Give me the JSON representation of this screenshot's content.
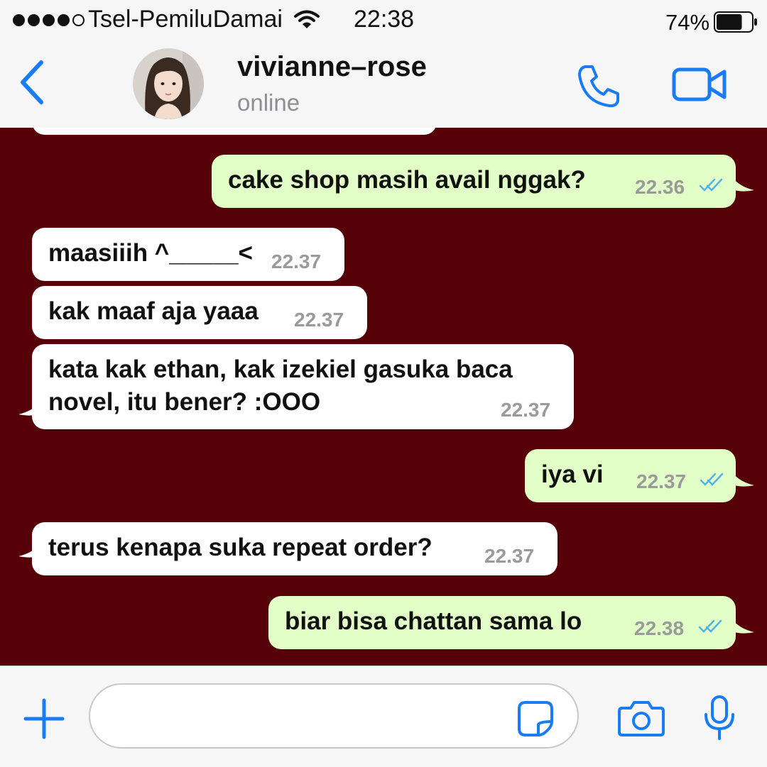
{
  "status_bar": {
    "carrier": "Tsel-PemiluDamai",
    "time": "22:38",
    "battery_percent": "74%",
    "battery_level": 0.74,
    "signal_bars_filled": 4,
    "signal_bars_total": 5,
    "icons": [
      "signal-dots-icon",
      "wifi-icon",
      "battery-icon"
    ]
  },
  "header": {
    "contact_name": "vivianne–rose",
    "presence": "online",
    "icons": [
      "back-chevron-icon",
      "avatar",
      "phone-icon",
      "video-camera-icon"
    ]
  },
  "messages": [
    {
      "direction": "outgoing",
      "text": "cake shop masih avail nggak?",
      "time": "22.36",
      "read": true
    },
    {
      "direction": "incoming",
      "text": "maasiiih ^_____<",
      "time": "22.37"
    },
    {
      "direction": "incoming",
      "text": "kak maaf aja yaaa",
      "time": "22.37"
    },
    {
      "direction": "incoming",
      "text_lines": [
        "kata kak ethan, kak izekiel gasuka baca",
        "novel, itu bener? :OOO"
      ],
      "time": "22.37"
    },
    {
      "direction": "outgoing",
      "text": "iya vi",
      "time": "22.37",
      "read": true
    },
    {
      "direction": "incoming",
      "text": "terus kenapa suka repeat order?",
      "time": "22.37"
    },
    {
      "direction": "outgoing",
      "text": "biar bisa chattan sama lo",
      "time": "22.38",
      "read": true
    }
  ],
  "input_bar": {
    "message_value": "",
    "icons": [
      "plus-icon",
      "sticker-icon",
      "camera-icon",
      "microphone-icon"
    ]
  },
  "colors": {
    "accent": "#1a7cf5",
    "chat_background": "#560008",
    "outgoing_bubble": "#e2ffc7",
    "incoming_bubble": "#ffffff",
    "read_ticks": "#4fb3ea",
    "timestamp": "#9a9a9a"
  }
}
